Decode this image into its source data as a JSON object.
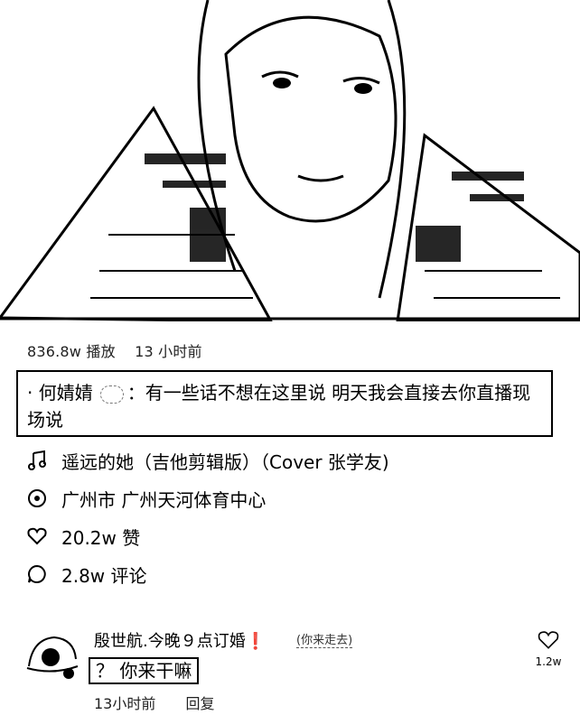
{
  "video": {
    "plays": "836.8w 播放",
    "time": "13 小时前"
  },
  "post": {
    "author": "· 何婧婧",
    "text": "：有一些话不想在这里说 明天我会直接去你直播现场说"
  },
  "music": {
    "icon": "music-note-icon",
    "label": "遥远的她（吉他剪辑版）（Cover 张学友)"
  },
  "location": {
    "icon": "location-icon",
    "label": "广州市 广州天河体育中心"
  },
  "likes": {
    "icon": "heart-icon",
    "label": "20.2w 赞"
  },
  "comments_count": {
    "icon": "comment-icon",
    "label": "2.8w 评论"
  },
  "comment": {
    "name": "殷世航.今晚９点订婚❗️",
    "extra": "(你来走去)",
    "text": "？ 你来干嘛",
    "time": "13小时前",
    "reply": "回复",
    "like_count": "1.2w"
  }
}
